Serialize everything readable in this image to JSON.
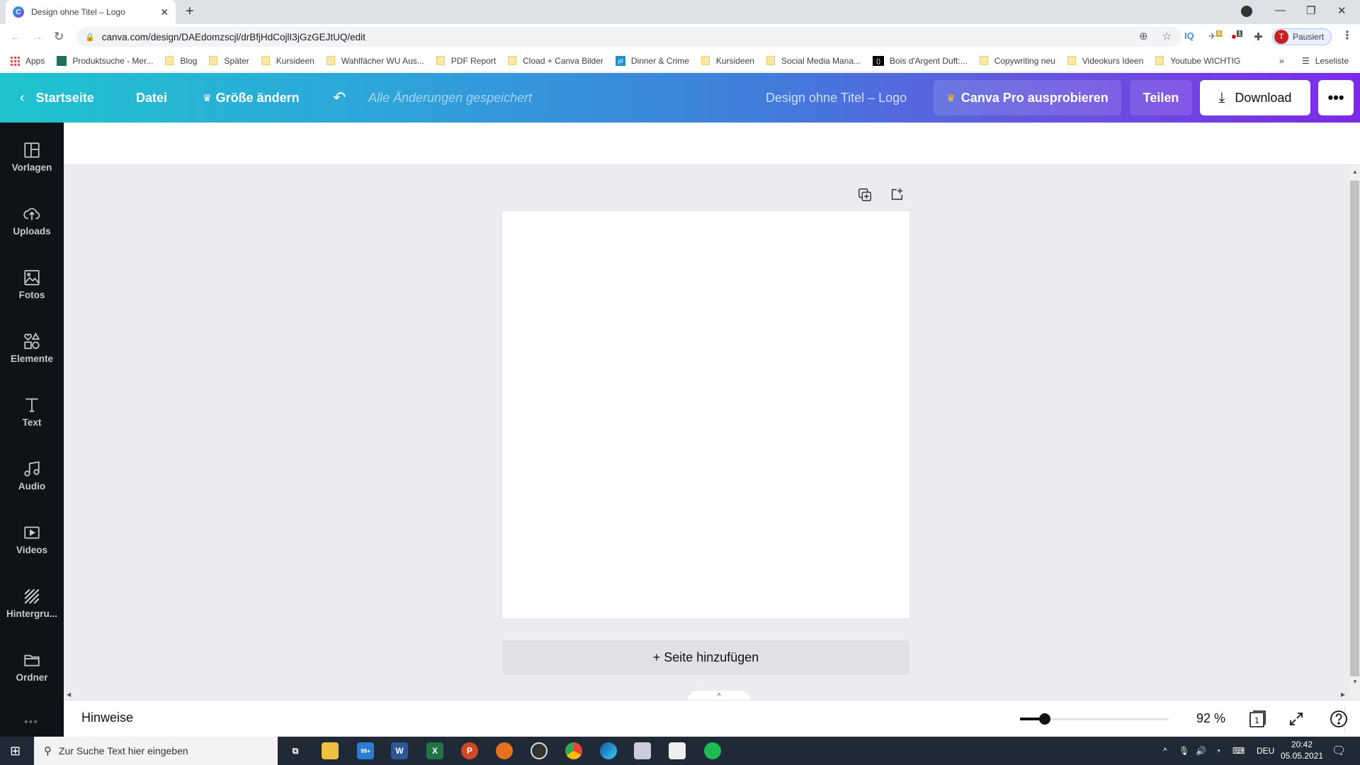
{
  "browser": {
    "tab_title": "Design ohne Titel – Logo",
    "tab_favicon": "C",
    "url": "canva.com/design/DAEdomzscjl/drBfjHdCojlI3jGzGEJtUQ/edit",
    "profile_initial": "T",
    "profile_label": "Pausiert",
    "extensions": [
      {
        "name": "IQ",
        "label": "IQ"
      },
      {
        "name": "bird-extension",
        "badge": "0"
      },
      {
        "name": "adblock",
        "badge": "1"
      }
    ],
    "bookmarks": [
      {
        "label": "Apps",
        "icon": "apps-icon"
      },
      {
        "label": "Produktsuche - Mer...",
        "icon": "site-icon"
      },
      {
        "label": "Blog",
        "icon": "folder-icon"
      },
      {
        "label": "Später",
        "icon": "folder-icon"
      },
      {
        "label": "Kursideen",
        "icon": "folder-icon"
      },
      {
        "label": "Wahlfächer WU Aus...",
        "icon": "folder-icon"
      },
      {
        "label": "PDF Report",
        "icon": "folder-icon"
      },
      {
        "label": "Cload + Canva Bilder",
        "icon": "folder-icon"
      },
      {
        "label": "Dinner & Crime",
        "icon": "jd-icon"
      },
      {
        "label": "Kursideen",
        "icon": "folder-icon"
      },
      {
        "label": "Social Media Mana...",
        "icon": "folder-icon"
      },
      {
        "label": "Bois d'Argent Duft:...",
        "icon": "bois-icon"
      },
      {
        "label": "Copywriting neu",
        "icon": "folder-icon"
      },
      {
        "label": "Videokurs Ideen",
        "icon": "folder-icon"
      },
      {
        "label": "Youtube WICHTIG",
        "icon": "folder-icon"
      }
    ],
    "bookmarks_overflow": "»",
    "reading_list": "Leseliste"
  },
  "header": {
    "home": "Startseite",
    "file": "Datei",
    "resize": "Größe ändern",
    "saved_status": "Alle Änderungen gespeichert",
    "doc_title": "Design ohne Titel – Logo",
    "pro_button": "Canva Pro ausprobieren",
    "share_button": "Teilen",
    "download_button": "Download",
    "more_button": "•••",
    "gradient_start": "#1fc4cf",
    "gradient_end": "#7d2ae8"
  },
  "sidebar": {
    "items": [
      {
        "label": "Vorlagen",
        "icon": "templates-icon"
      },
      {
        "label": "Uploads",
        "icon": "upload-cloud-icon"
      },
      {
        "label": "Fotos",
        "icon": "photo-icon"
      },
      {
        "label": "Elemente",
        "icon": "elements-icon"
      },
      {
        "label": "Text",
        "icon": "text-icon"
      },
      {
        "label": "Audio",
        "icon": "music-note-icon"
      },
      {
        "label": "Videos",
        "icon": "video-icon"
      },
      {
        "label": "Hintergru...",
        "icon": "background-icon"
      },
      {
        "label": "Ordner",
        "icon": "folder-icon"
      }
    ],
    "more": "•••"
  },
  "canvas": {
    "add_page": "+ Seite hinzufügen"
  },
  "footer": {
    "notes": "Hinweise",
    "zoom_percent": 92,
    "zoom_label": "92 %",
    "page_count": "1"
  },
  "taskbar": {
    "search_placeholder": "Zur Suche Text hier eingeben",
    "mail_badge": "99+",
    "language": "DEU",
    "time": "20:42",
    "date": "05.05.2021"
  }
}
